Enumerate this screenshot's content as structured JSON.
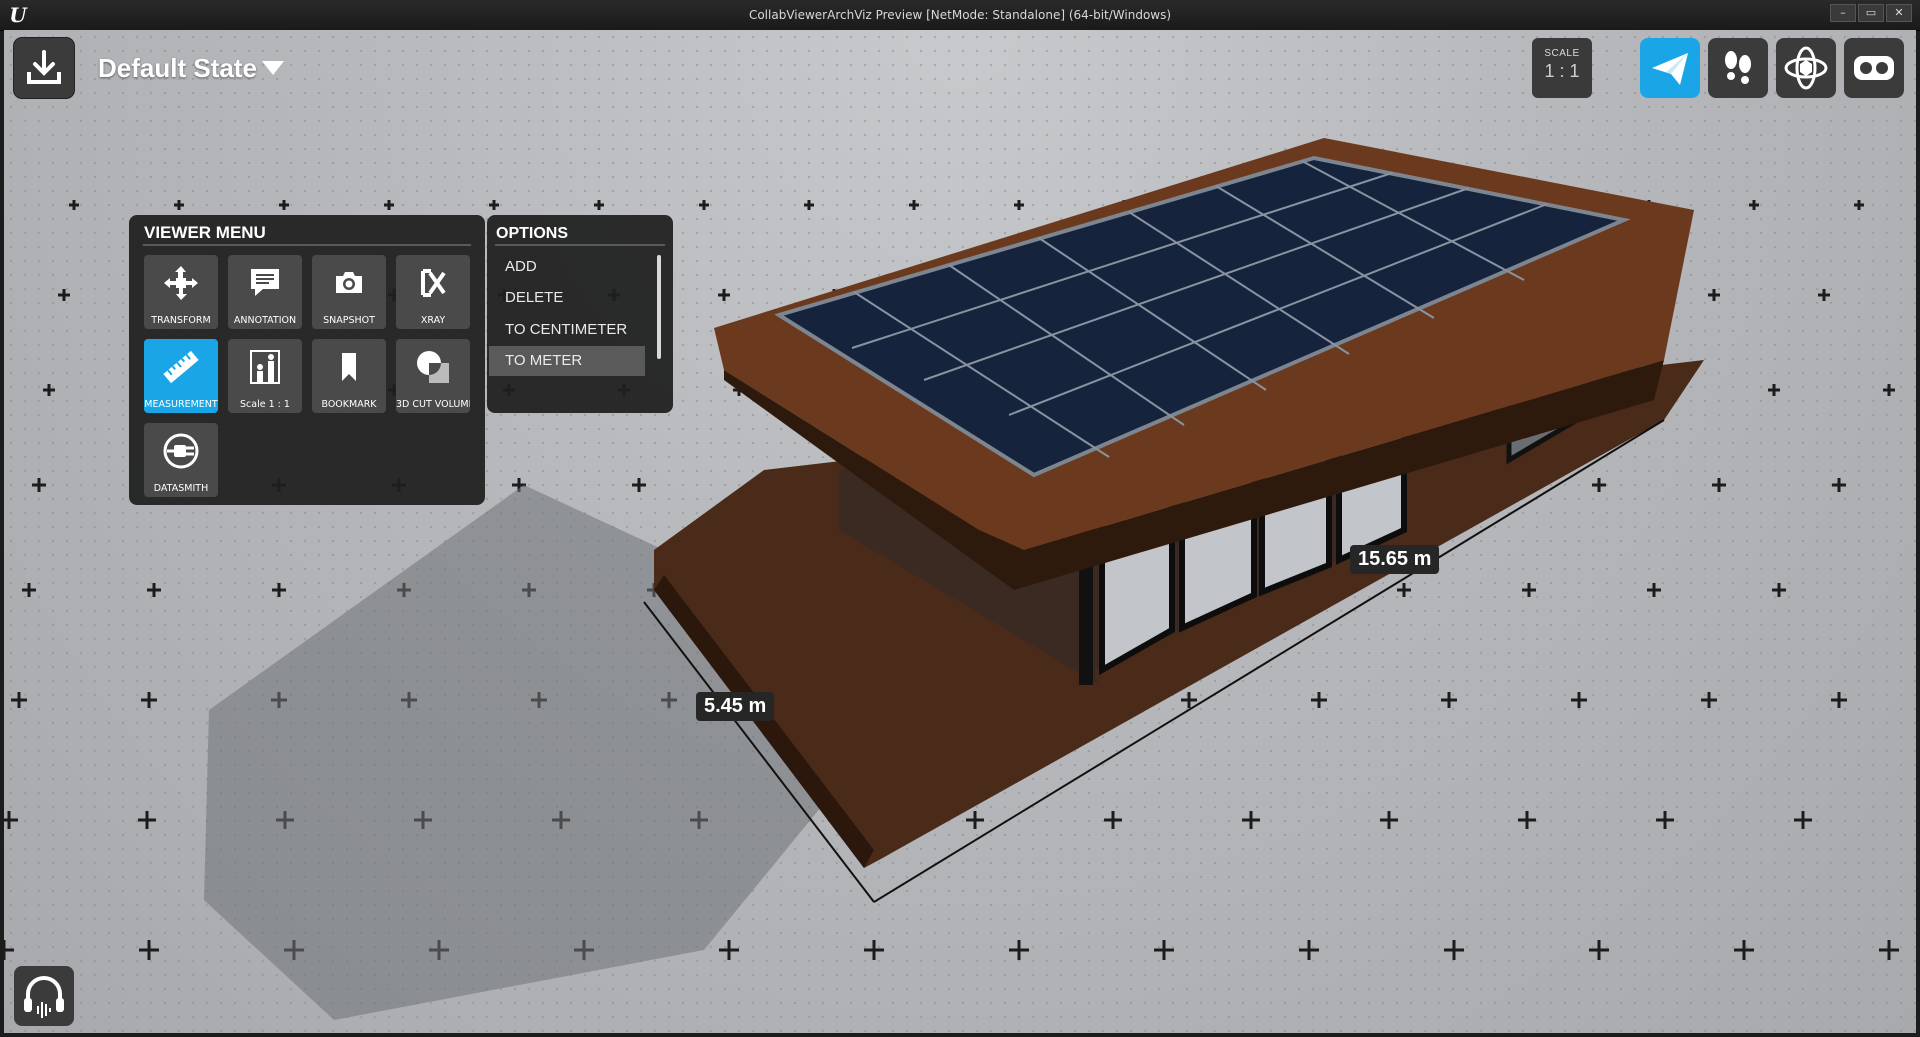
{
  "window": {
    "title": "CollabViewerArchViz Preview [NetMode: Standalone]  (64-bit/Windows)",
    "logo": "U",
    "controls": [
      "–",
      "▭",
      "✕"
    ]
  },
  "header": {
    "state_title": "Default State",
    "scale_label": "SCALE",
    "scale_value": "1 : 1"
  },
  "viewer_menu": {
    "title": "VIEWER MENU",
    "tools": [
      {
        "label": "TRANSFORM",
        "icon": "transform-icon"
      },
      {
        "label": "ANNOTATION",
        "icon": "annotation-icon"
      },
      {
        "label": "SNAPSHOT",
        "icon": "camera-icon"
      },
      {
        "label": "XRAY",
        "icon": "xray-icon"
      },
      {
        "label": "MEASUREMENT",
        "icon": "ruler-icon",
        "active": true
      },
      {
        "label": "Scale 1 : 1",
        "icon": "scale-people-icon"
      },
      {
        "label": "BOOKMARK",
        "icon": "bookmark-icon"
      },
      {
        "label": "3D CUT VOLUME",
        "icon": "cut-volume-icon"
      },
      {
        "label": "DATASMITH",
        "icon": "plug-icon"
      }
    ]
  },
  "options": {
    "title": "OPTIONS",
    "items": [
      "ADD",
      "DELETE",
      "TO CENTIMETER",
      "TO METER"
    ],
    "hovered": "TO METER"
  },
  "measurements": [
    "15.65 m",
    "5.45 m"
  ],
  "nav_modes": [
    "fly-icon",
    "walk-icon",
    "orbit-icon",
    "vr-icon"
  ],
  "colors": {
    "accent": "#1aa6e6",
    "panel": "#1e1e1e",
    "button": "#4a4a4a"
  }
}
